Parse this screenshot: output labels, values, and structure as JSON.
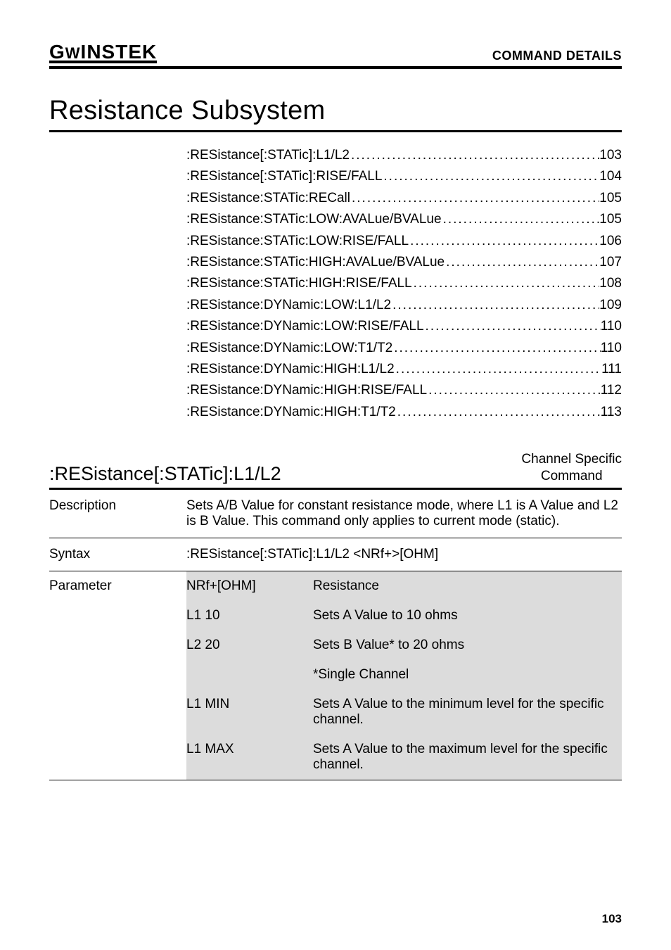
{
  "header": {
    "logo": "GWINSTEK",
    "section": "COMMAND DETAILS"
  },
  "heading": "Resistance Subsystem",
  "toc": [
    {
      "label": ":RESistance[:STATic]:L1/L2",
      "page": "103"
    },
    {
      "label": ":RESistance[:STATic]:RISE/FALL",
      "page": "104"
    },
    {
      "label": ":RESistance:STATic:RECall",
      "page": "105"
    },
    {
      "label": ":RESistance:STATic:LOW:AVALue/BVALue",
      "page": "105"
    },
    {
      "label": ":RESistance:STATic:LOW:RISE/FALL",
      "page": "106"
    },
    {
      "label": ":RESistance:STATic:HIGH:AVALue/BVALue",
      "page": "107"
    },
    {
      "label": ":RESistance:STATic:HIGH:RISE/FALL",
      "page": "108"
    },
    {
      "label": ":RESistance:DYNamic:LOW:L1/L2",
      "page": "109"
    },
    {
      "label": ":RESistance:DYNamic:LOW:RISE/FALL",
      "page": "110"
    },
    {
      "label": ":RESistance:DYNamic:LOW:T1/T2",
      "page": "110"
    },
    {
      "label": ":RESistance:DYNamic:HIGH:L1/L2",
      "page": "111"
    },
    {
      "label": ":RESistance:DYNamic:HIGH:RISE/FALL",
      "page": "112"
    },
    {
      "label": ":RESistance:DYNamic:HIGH:T1/T2",
      "page": "113"
    }
  ],
  "command": {
    "title": ":RESistance[:STATic]:L1/L2",
    "badge_line1": "Channel Specific",
    "badge_line2": "Command",
    "description_label": "Description",
    "description_text": "Sets A/B Value for constant resistance mode, where L1 is A Value and L2 is B Value. This command only applies to current mode (static).",
    "syntax_label": "Syntax",
    "syntax_text": ":RESistance[:STATic]:L1/L2 <NRf+>[OHM]",
    "parameter_label": "Parameter",
    "param_rows": [
      {
        "arg": "NRf+[OHM]",
        "meaning": "Resistance"
      },
      {
        "arg": "L1 10",
        "meaning": "Sets A Value to 10 ohms"
      },
      {
        "arg": "L2 20",
        "meaning": "Sets B Value* to 20 ohms"
      },
      {
        "arg": "",
        "meaning": "*Single Channel"
      },
      {
        "arg": "L1 MIN",
        "meaning": "Sets A Value to the minimum level for the specific channel."
      },
      {
        "arg": "L1 MAX",
        "meaning": "Sets A Value to the maximum level for the specific channel."
      }
    ]
  },
  "page_number": "103"
}
